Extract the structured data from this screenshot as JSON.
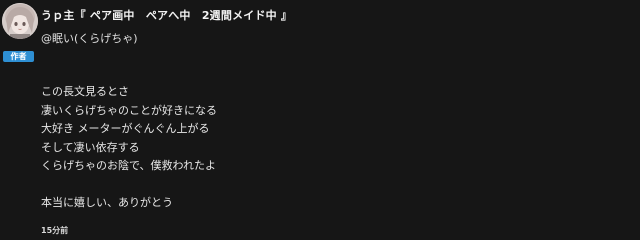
{
  "comment": {
    "username": "うｐ主『 ペア画中　ペアへ中　2週間メイド中 』",
    "handle": "@眠い(くらげちゃ)",
    "badge": "作者",
    "body_lines": [
      "この長文見るとさ",
      "凄いくらげちゃのことが好きになる",
      "大好き メーターがぐんぐん上がる",
      "そして凄い依存する",
      "くらげちゃのお陰で、僕救われたよ",
      "",
      "本当に嬉しい、ありがとう"
    ],
    "timestamp": "15分前"
  },
  "colors": {
    "background": "#161616",
    "badge": "#2e8fd3",
    "text": "#e8e8e8"
  },
  "icons": {
    "avatar": "anime-girl-avatar"
  }
}
